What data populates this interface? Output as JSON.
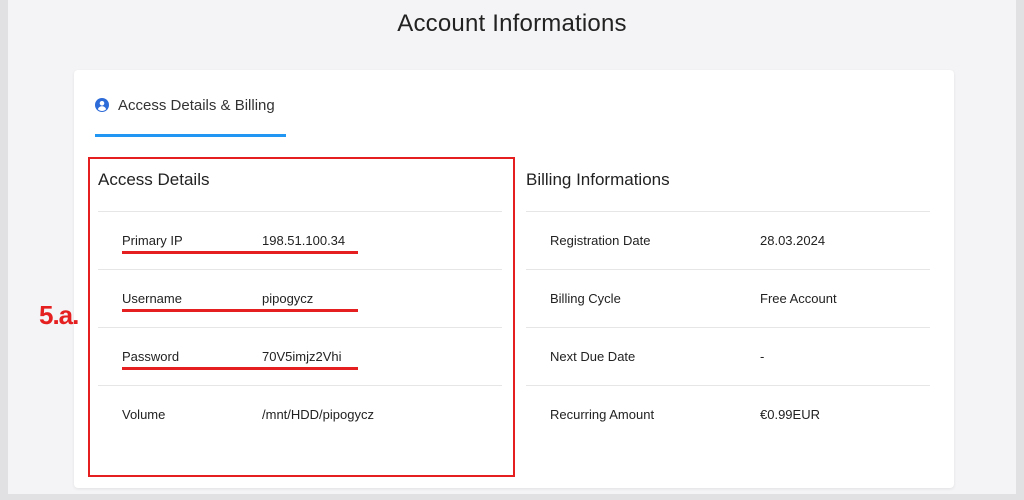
{
  "page": {
    "title": "Account Informations"
  },
  "tab": {
    "label": "Access Details & Billing",
    "icon": "user-circle-icon",
    "accent_color": "#2196f3"
  },
  "access_details": {
    "title": "Access Details",
    "rows": [
      {
        "label": "Primary IP",
        "value": "198.51.100.34"
      },
      {
        "label": "Username",
        "value": "pipogycz"
      },
      {
        "label": "Password",
        "value": "70V5imjz2Vhi"
      },
      {
        "label": "Volume",
        "value": "/mnt/HDD/pipogycz"
      }
    ]
  },
  "billing": {
    "title": "Billing Informations",
    "rows": [
      {
        "label": "Registration Date",
        "value": "28.03.2024"
      },
      {
        "label": "Billing Cycle",
        "value": "Free Account"
      },
      {
        "label": "Next Due Date",
        "value": "-"
      },
      {
        "label": "Recurring Amount",
        "value": "€0.99EUR"
      }
    ]
  },
  "annotation": {
    "step_label": "5.a.",
    "color": "#e51f1f"
  }
}
